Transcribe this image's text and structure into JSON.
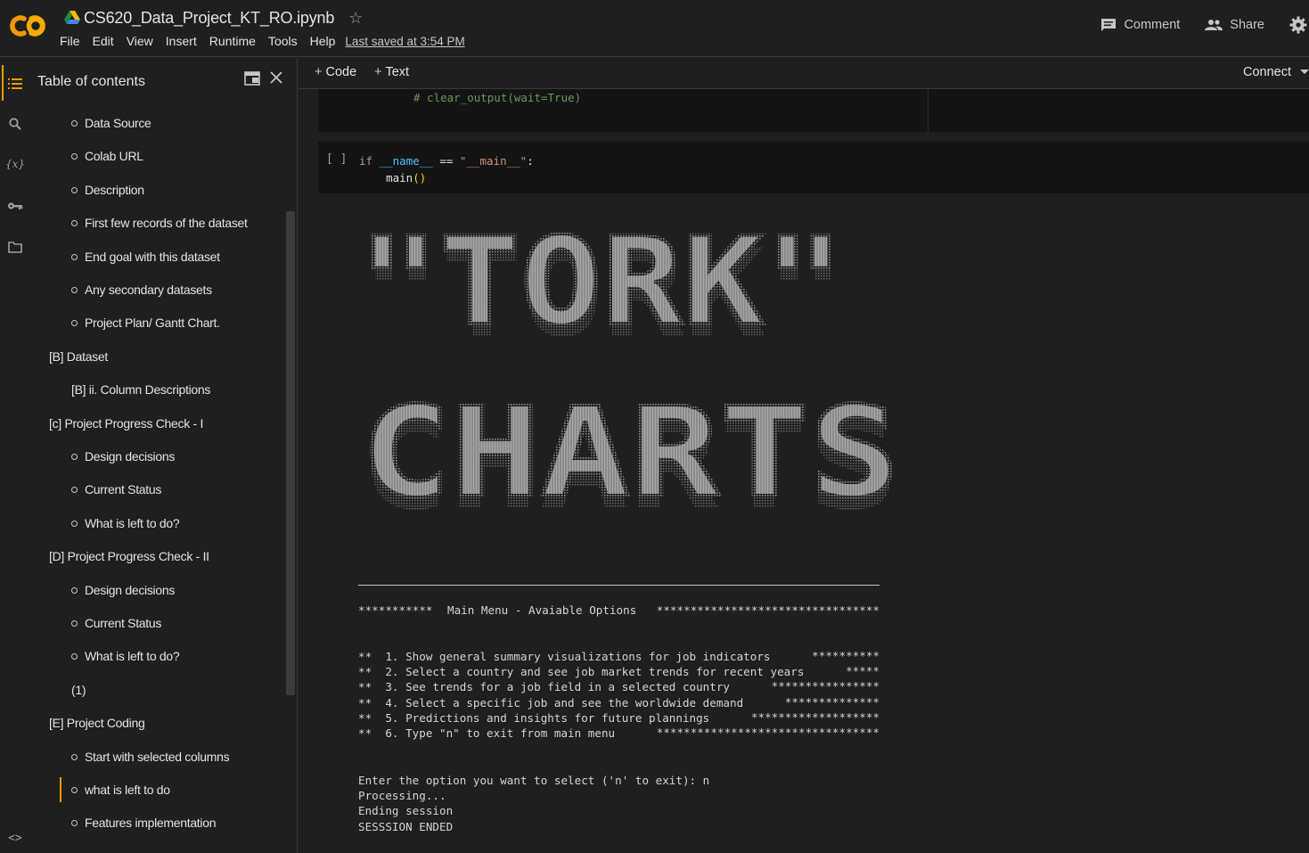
{
  "header": {
    "title": "CS620_Data_Project_KT_RO.ipynb",
    "menu": [
      "File",
      "Edit",
      "View",
      "Insert",
      "Runtime",
      "Tools",
      "Help"
    ],
    "last_saved": "Last saved at 3:54 PM",
    "comment_label": "Comment",
    "share_label": "Share"
  },
  "toc": {
    "title": "Table of contents",
    "items": [
      {
        "label": "Data Source",
        "level": 2
      },
      {
        "label": "Colab URL",
        "level": 2
      },
      {
        "label": "Description",
        "level": 2
      },
      {
        "label": "First few records of the dataset",
        "level": 2
      },
      {
        "label": "End goal with this dataset",
        "level": 2
      },
      {
        "label": "Any secondary datasets",
        "level": 2
      },
      {
        "label": "Project Plan/ Gantt Chart.",
        "level": 2
      },
      {
        "label": "[B] Dataset",
        "level": 0
      },
      {
        "label": "[B] ii. Column Descriptions",
        "level": 1
      },
      {
        "label": "[c] Project Progress Check - I",
        "level": 0
      },
      {
        "label": "Design decisions",
        "level": 2
      },
      {
        "label": "Current Status",
        "level": 2
      },
      {
        "label": "What is left to do?",
        "level": 2
      },
      {
        "label": "[D] Project Progress Check - II",
        "level": 0
      },
      {
        "label": "Design decisions",
        "level": 2
      },
      {
        "label": "Current Status",
        "level": 2
      },
      {
        "label": "What is left to do?",
        "level": 2
      },
      {
        "label": "(1)",
        "level": 1
      },
      {
        "label": "[E] Project Coding",
        "level": 0
      },
      {
        "label": "Start with selected columns",
        "level": 2
      },
      {
        "label": "what is left to do",
        "level": 2,
        "active": true
      },
      {
        "label": "Features implementation",
        "level": 2
      }
    ]
  },
  "toolbar": {
    "code_label": "Code",
    "text_label": "Text",
    "connect_label": "Connect"
  },
  "cells": {
    "cell1_code": "# clear_output(wait=True)",
    "cell2_bracket": "[ ]",
    "cell2_if": "if",
    "cell2_name": "__name__",
    "cell2_eq": " == ",
    "cell2_str": "\"__main__\"",
    "cell2_colon": ":",
    "cell2_call": "main",
    "cell2_parens": "()"
  },
  "output": {
    "banner_line1": "\"TORK\"",
    "banner_line2": "CHARTS",
    "menu_header_left": "***********",
    "menu_header_title": "Main Menu - Avaiable Options",
    "menu_header_right": "*********************************",
    "options": [
      {
        "text": "**  1. Show general summary visualizations for job indicators",
        "stars": "**********"
      },
      {
        "text": "**  2. Select a country and see job market trends for recent years",
        "stars": "*****"
      },
      {
        "text": "**  3. See trends for a job field in a selected country",
        "stars": "****************"
      },
      {
        "text": "**  4. Select a specific job and see the worldwide demand",
        "stars": "**************"
      },
      {
        "text": "**  5. Predictions and insights for future plannings",
        "stars": "*******************"
      },
      {
        "text": "**  6. Type \"n\" to exit from main menu",
        "stars": "*********************************"
      }
    ],
    "prompt_line": "Enter the option you want to select ('n' to exit): n",
    "processing": "Processing...",
    "ending": "Ending session",
    "ended": "SESSSION ENDED"
  },
  "colors": {
    "accent": "#f29900",
    "background": "#1f1f1f",
    "cell_bg": "#141414",
    "comment_green": "#6a9955"
  }
}
